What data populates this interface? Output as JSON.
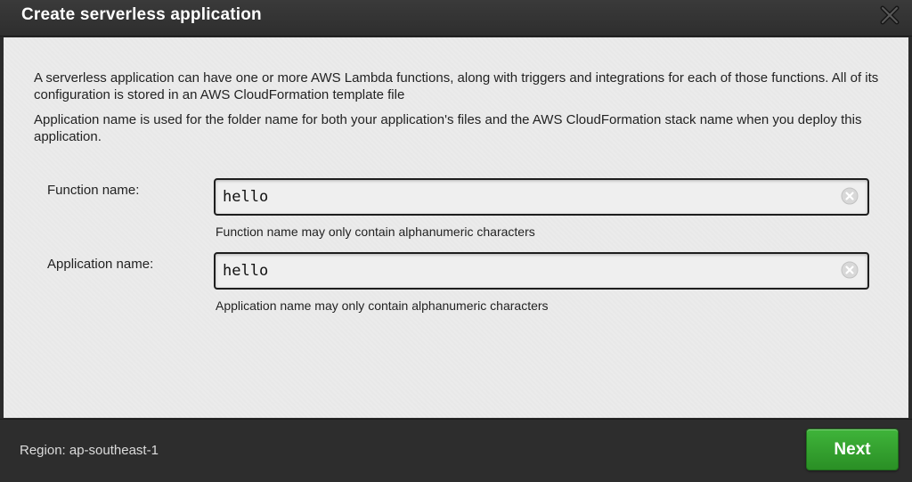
{
  "dialog": {
    "title": "Create serverless application",
    "close_icon": "close-icon"
  },
  "description": {
    "paragraph1": "A serverless application can have one or more AWS Lambda functions, along with triggers and integrations for each of those functions. All of its configuration is stored in an AWS CloudFormation template file",
    "paragraph2": "Application name is used for the folder name for both your application's files and the AWS CloudFormation stack name when you deploy this application."
  },
  "form": {
    "function": {
      "label": "Function name:",
      "value": "hello",
      "hint": "Function name may only contain alphanumeric characters",
      "clear_icon": "clear-icon"
    },
    "application": {
      "label": "Application name:",
      "value": "hello",
      "hint": "Application name may only contain alphanumeric characters",
      "clear_icon": "clear-icon"
    }
  },
  "footer": {
    "region_text": "Region: ap-southeast-1",
    "next_label": "Next"
  },
  "colors": {
    "title_bar": "#2e2e2e",
    "content_bg": "#ebebeb",
    "next_button": "#2e9a29"
  }
}
